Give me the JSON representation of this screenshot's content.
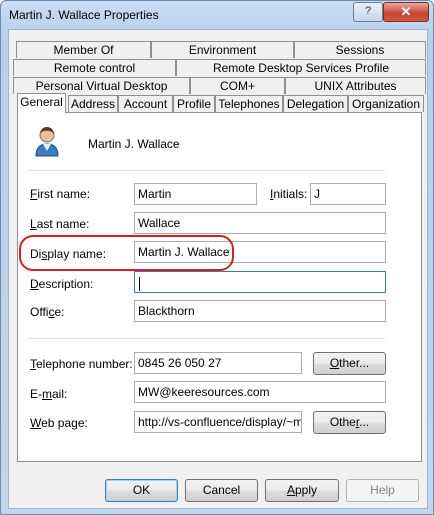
{
  "window": {
    "title": "Martin J. Wallace Properties",
    "help_glyph": "?",
    "close_glyph": "✕"
  },
  "tabs": {
    "row1": [
      "Member Of",
      "Environment",
      "Sessions"
    ],
    "row2": [
      "Remote control",
      "Remote Desktop Services Profile"
    ],
    "row3": [
      "Personal Virtual Desktop",
      "COM+",
      "UNIX Attributes"
    ],
    "row4": [
      "General",
      "Address",
      "Account",
      "Profile",
      "Telephones",
      "Delegation",
      "Organization"
    ],
    "active": "General"
  },
  "user": {
    "name": "Martin J. Wallace",
    "icon": "user-icon"
  },
  "fields": {
    "first_name": {
      "label_u": "F",
      "label_rest": "irst name:",
      "value": "Martin"
    },
    "initials": {
      "label_u": "I",
      "label_rest": "nitials:",
      "value": "J"
    },
    "last_name": {
      "label_u": "L",
      "label_rest": "ast name:",
      "value": "Wallace"
    },
    "display_name": {
      "label_pre": "Di",
      "label_u": "s",
      "label_rest": "play name:",
      "value": "Martin J. Wallace"
    },
    "description": {
      "label_u": "D",
      "label_rest": "escription:",
      "value": ""
    },
    "office": {
      "label_pre": "Offi",
      "label_u": "c",
      "label_rest": "e:",
      "value": "Blackthorn"
    },
    "telephone": {
      "label_u": "T",
      "label_rest": "elephone number:",
      "value": "0845 26 050 27"
    },
    "email": {
      "label_pre": "E-",
      "label_u": "m",
      "label_rest": "ail:",
      "value": "MW@keeresources.com"
    },
    "webpage": {
      "label_u": "W",
      "label_rest": "eb page:",
      "value": "http://vs-confluence/display/~mw"
    }
  },
  "buttons": {
    "other_phone_u": "O",
    "other_phone_rest": "ther...",
    "other_web_u": "",
    "other_web_pre": "Othe",
    "other_web_u2": "r",
    "other_web_rest": "...",
    "ok": "OK",
    "cancel": "Cancel",
    "apply_u": "A",
    "apply_rest": "pply",
    "help": "Help"
  },
  "colors": {
    "highlight": "#d42020",
    "focus_border": "#3d7bad"
  }
}
